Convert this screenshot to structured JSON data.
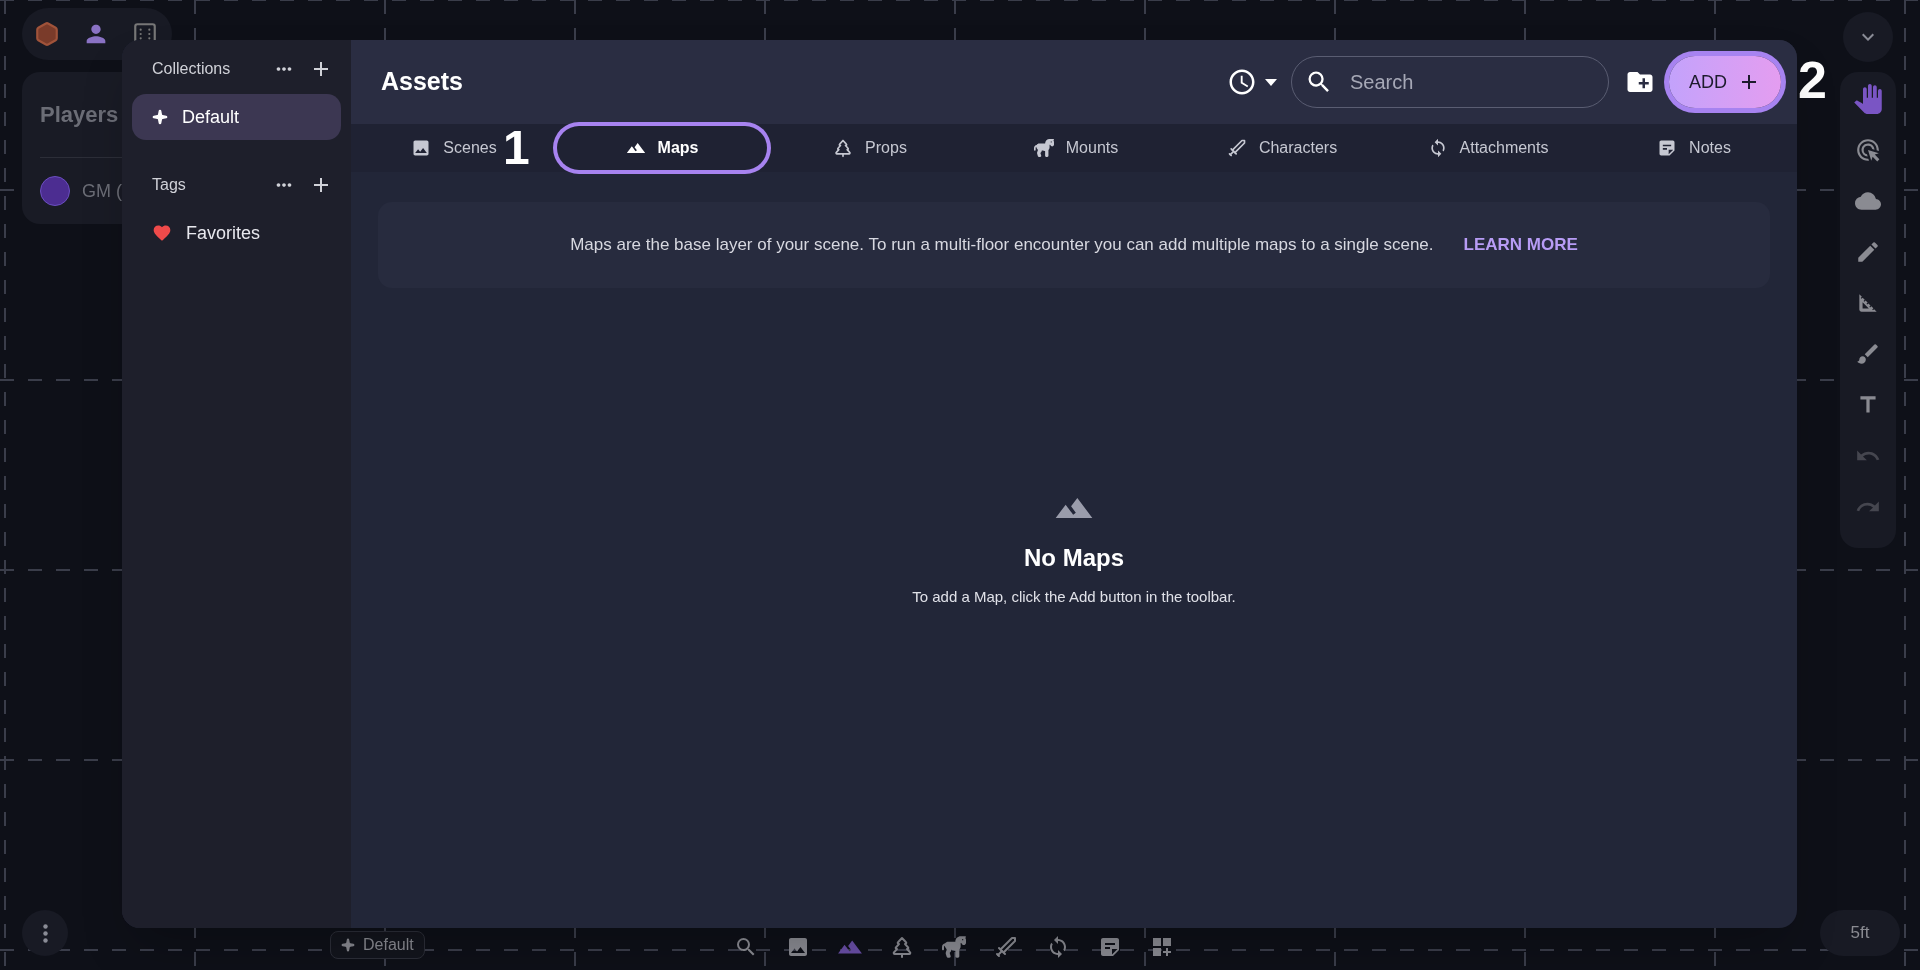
{
  "background": {
    "players_title": "Players",
    "player_name": "GM (",
    "collection_chip": "Default",
    "scale": "5ft",
    "asset_bar": [
      {
        "kind": "search",
        "selected": false
      },
      {
        "kind": "scenes",
        "selected": false
      },
      {
        "kind": "maps",
        "selected": true
      },
      {
        "kind": "props",
        "selected": false
      },
      {
        "kind": "mounts",
        "selected": false
      },
      {
        "kind": "characters",
        "selected": false
      },
      {
        "kind": "attachments",
        "selected": false
      },
      {
        "kind": "notes",
        "selected": false
      },
      {
        "kind": "add",
        "selected": false
      }
    ],
    "tools": [
      {
        "kind": "hand",
        "selected": true
      },
      {
        "kind": "select",
        "selected": false
      },
      {
        "kind": "fog",
        "selected": false
      },
      {
        "kind": "draw",
        "selected": false
      },
      {
        "kind": "measure",
        "selected": false
      },
      {
        "kind": "pointer",
        "selected": false
      },
      {
        "kind": "text",
        "selected": false
      },
      {
        "kind": "undo",
        "selected": false
      },
      {
        "kind": "redo",
        "selected": false
      }
    ]
  },
  "sidebar": {
    "sections": [
      {
        "title": "Collections",
        "items": [
          {
            "label": "Default",
            "kind": "collection",
            "selected": true
          }
        ]
      },
      {
        "title": "Tags",
        "items": [
          {
            "label": "Favorites",
            "kind": "tag",
            "selected": false
          }
        ]
      }
    ]
  },
  "header": {
    "title": "Assets",
    "search": {
      "placeholder": "Search"
    },
    "add_button": {
      "label": "ADD",
      "callout": "2"
    }
  },
  "tabs": [
    {
      "label": "Scenes",
      "kind": "scenes",
      "selected": false
    },
    {
      "label": "Maps",
      "kind": "maps",
      "selected": true,
      "callout": "1"
    },
    {
      "label": "Props",
      "kind": "props",
      "selected": false
    },
    {
      "label": "Mounts",
      "kind": "mounts",
      "selected": false
    },
    {
      "label": "Characters",
      "kind": "characters",
      "selected": false
    },
    {
      "label": "Attachments",
      "kind": "attachments",
      "selected": false
    },
    {
      "label": "Notes",
      "kind": "notes",
      "selected": false
    }
  ],
  "info": {
    "text": "Maps are the base layer of your scene. To run a multi-floor encounter you can add multiple maps to a single scene.",
    "link": "LEARN MORE"
  },
  "empty_state": {
    "title": "No Maps",
    "text": "To add a Map, click the Add button in the toolbar."
  }
}
